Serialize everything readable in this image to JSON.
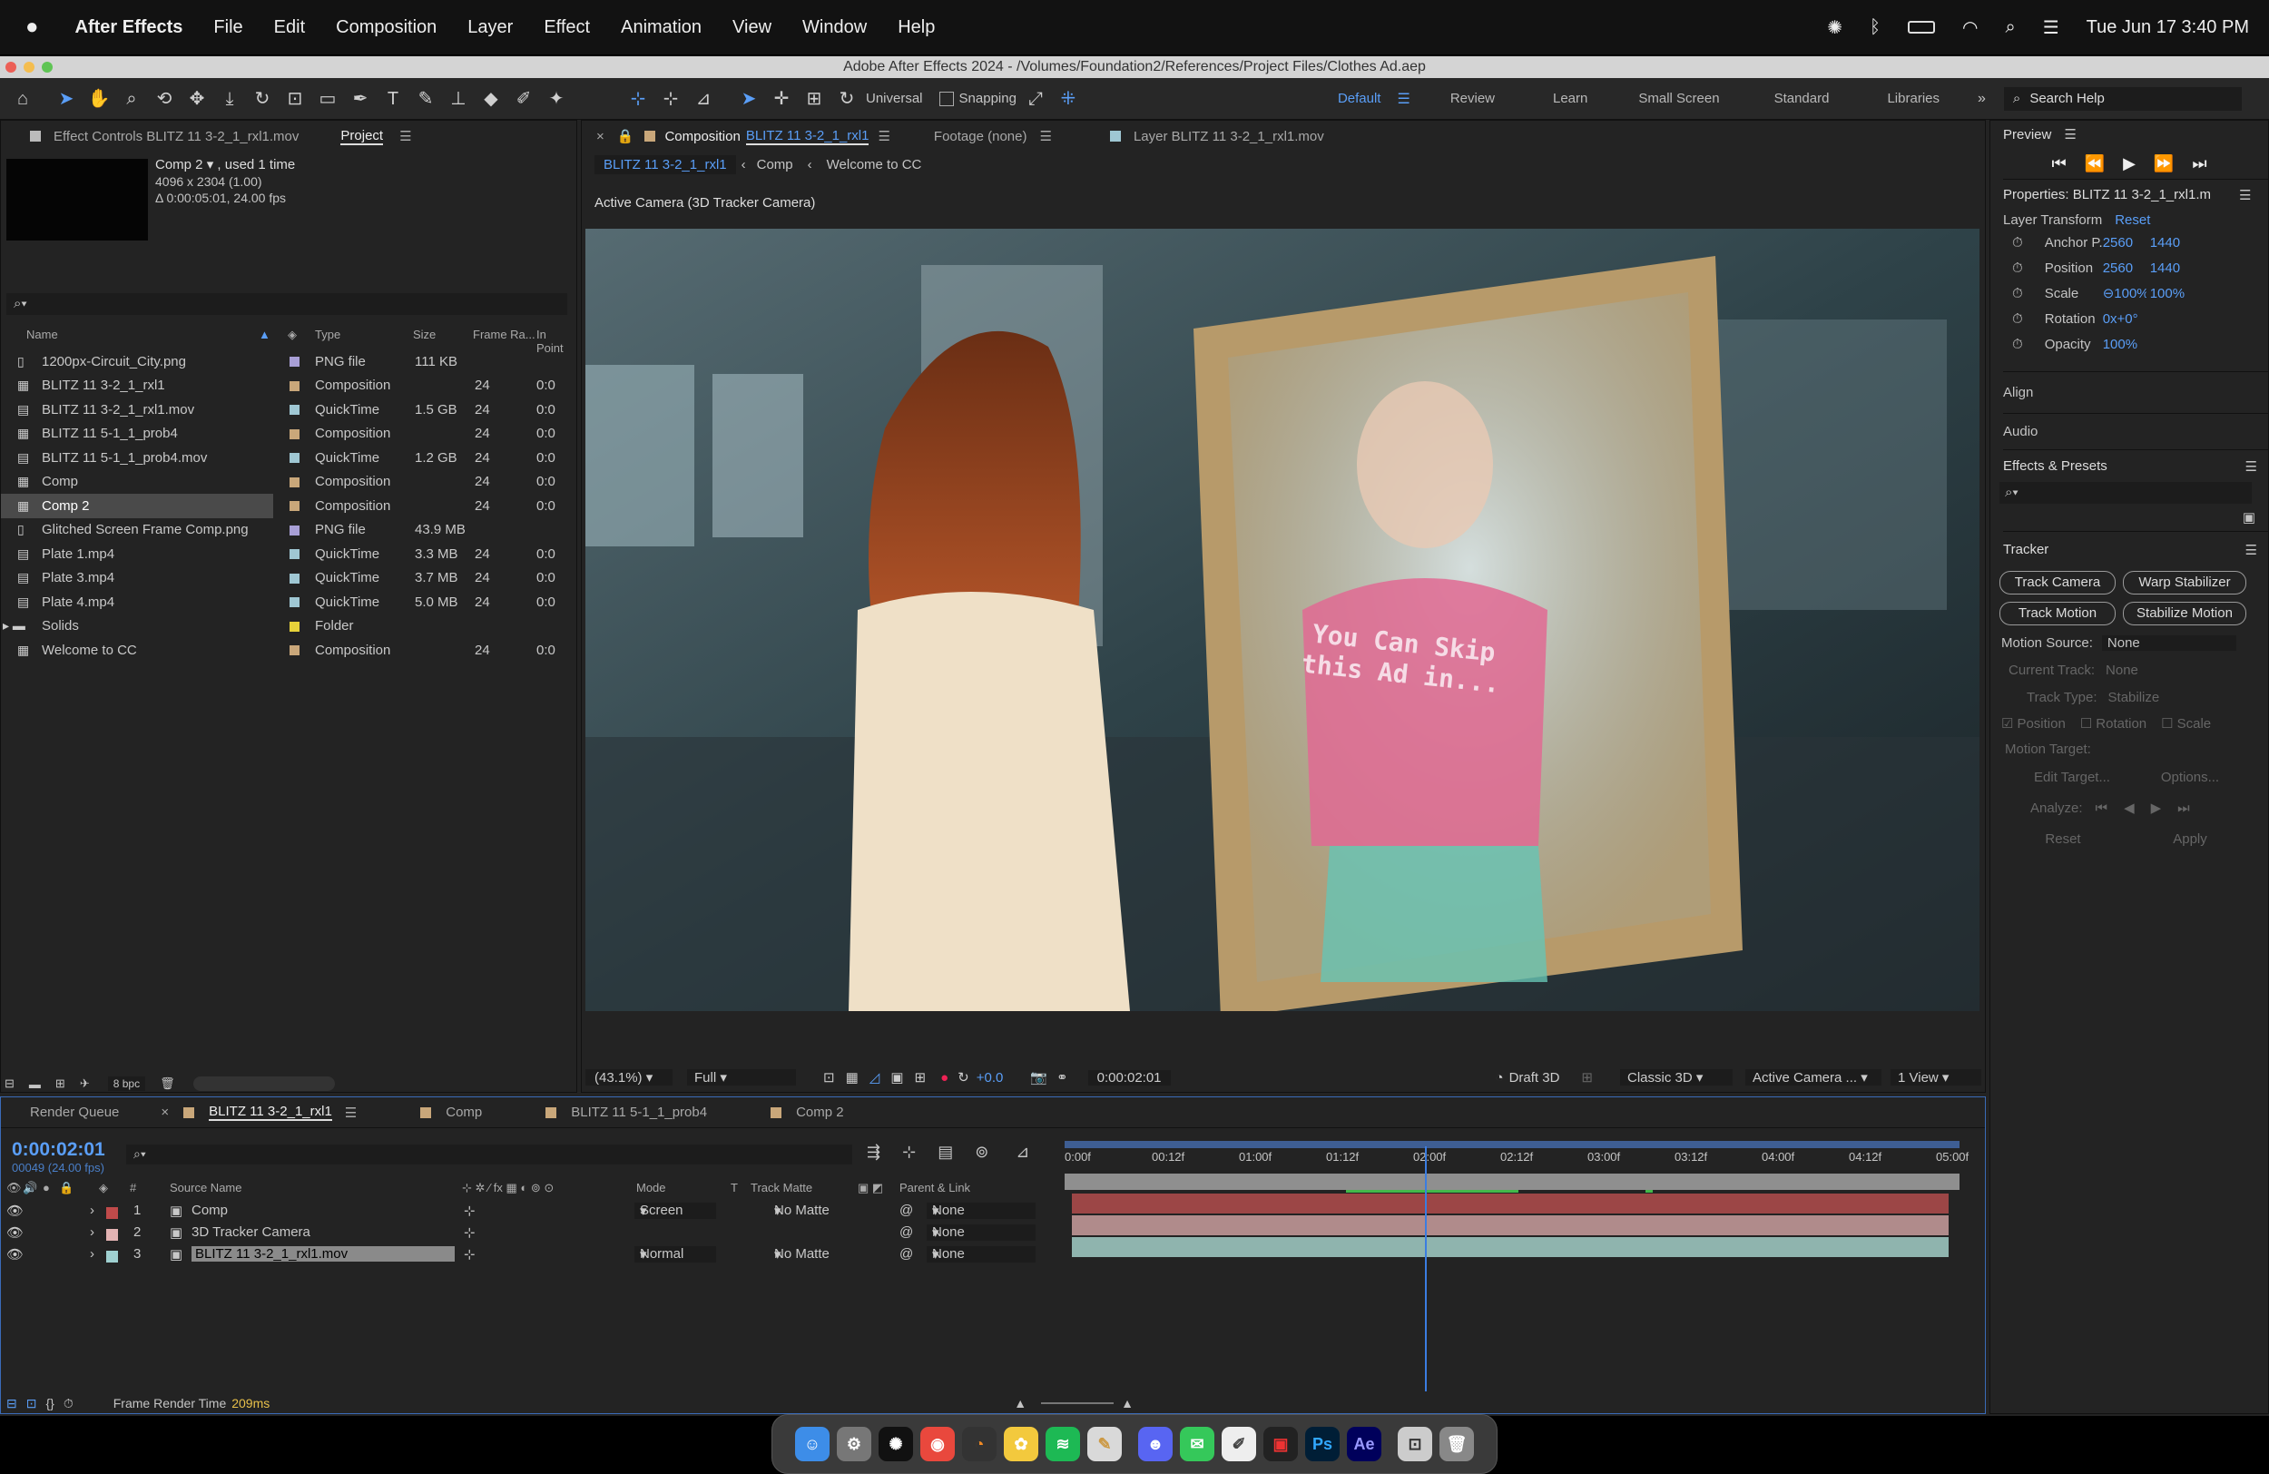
{
  "menubar": {
    "app": "After Effects",
    "items": [
      "File",
      "Edit",
      "Composition",
      "Layer",
      "Effect",
      "Animation",
      "View",
      "Window",
      "Help"
    ],
    "clock": "Tue Jun 17  3:40 PM"
  },
  "window": {
    "title": "Adobe After Effects 2024 - /Volumes/Foundation2/References/Project Files/Clothes Ad.aep"
  },
  "toolbar": {
    "universal": "Universal",
    "snapping": "Snapping",
    "workspaces": [
      "Default",
      "Review",
      "Learn",
      "Small Screen",
      "Standard",
      "Libraries"
    ],
    "search": "Search Help"
  },
  "project": {
    "tab_effect_controls": "Effect Controls BLITZ 11 3-2_1_rxl1.mov",
    "tab_project": "Project",
    "preview_name": "Comp 2 ▾ , used 1 time",
    "preview_info1": "4096 x 2304 (1.00)",
    "preview_info2": "Δ 0:00:05:01, 24.00 fps",
    "search_placeholder": "⌕▾",
    "columns": [
      "Name",
      "Type",
      "Size",
      "Frame Ra...",
      "In Point"
    ],
    "items": [
      {
        "name": "1200px-Circuit_City.png",
        "type": "PNG file",
        "size": "111 KB",
        "fps": "",
        "in": "",
        "color": "#a89fd6"
      },
      {
        "name": "BLITZ 11 3-2_1_rxl1",
        "type": "Composition",
        "size": "",
        "fps": "24",
        "in": "0:0",
        "color": "#c9a77a"
      },
      {
        "name": "BLITZ 11 3-2_1_rxl1.mov",
        "type": "QuickTime",
        "size": "1.5 GB",
        "fps": "24",
        "in": "0:0",
        "color": "#9fc7d3"
      },
      {
        "name": "BLITZ 11 5-1_1_prob4",
        "type": "Composition",
        "size": "",
        "fps": "24",
        "in": "0:0",
        "color": "#c9a77a"
      },
      {
        "name": "BLITZ 11 5-1_1_prob4.mov",
        "type": "QuickTime",
        "size": "1.2 GB",
        "fps": "24",
        "in": "0:0",
        "color": "#9fc7d3"
      },
      {
        "name": "Comp",
        "type": "Composition",
        "size": "",
        "fps": "24",
        "in": "0:0",
        "color": "#c9a77a"
      },
      {
        "name": "Comp 2",
        "type": "Composition",
        "size": "",
        "fps": "24",
        "in": "0:0",
        "color": "#c9a77a"
      },
      {
        "name": "Glitched Screen Frame Comp.png",
        "type": "PNG file",
        "size": "43.9 MB",
        "fps": "",
        "in": "",
        "color": "#a89fd6"
      },
      {
        "name": "Plate 1.mp4",
        "type": "QuickTime",
        "size": "3.3 MB",
        "fps": "24",
        "in": "0:0",
        "color": "#9fc7d3"
      },
      {
        "name": "Plate 3.mp4",
        "type": "QuickTime",
        "size": "3.7 MB",
        "fps": "24",
        "in": "0:0",
        "color": "#9fc7d3"
      },
      {
        "name": "Plate 4.mp4",
        "type": "QuickTime",
        "size": "5.0 MB",
        "fps": "24",
        "in": "0:0",
        "color": "#9fc7d3"
      },
      {
        "name": "Solids",
        "type": "Folder",
        "size": "",
        "fps": "",
        "in": "",
        "color": "#e6d23a"
      },
      {
        "name": "Welcome to CC",
        "type": "Composition",
        "size": "",
        "fps": "24",
        "in": "0:0",
        "color": "#c9a77a"
      }
    ],
    "bpc": "8 bpc"
  },
  "comp": {
    "tab_comp_prefix": "Composition",
    "tab_comp_name": "BLITZ 11 3-2_1_rxl1",
    "tab_footage": "Footage (none)",
    "tab_layer": "Layer BLITZ 11 3-2_1_rxl1.mov",
    "crumbs": [
      "BLITZ 11 3-2_1_rxl1",
      "Comp",
      "Welcome to CC"
    ],
    "camera_label": "Active Camera (3D Tracker Camera)",
    "overlay_text1": "You Can Skip",
    "overlay_text2": "this Ad in...",
    "zoom": "(43.1%)",
    "resolution": "Full",
    "exposure": "+0.0",
    "timecode": "0:00:02:01",
    "draft": "Draft 3D",
    "renderer": "Classic 3D",
    "camera": "Active Camera ...",
    "views": "1 View"
  },
  "right": {
    "preview": "Preview",
    "properties_title": "Properties: BLITZ 11 3-2_1_rxl1.m",
    "layer_transform": "Layer Transform",
    "reset": "Reset",
    "props": [
      {
        "name": "Anchor P...",
        "v1": "2560",
        "v2": "1440"
      },
      {
        "name": "Position",
        "v1": "2560",
        "v2": "1440"
      },
      {
        "name": "Scale",
        "v1": "⊖100%",
        "v2": "100%"
      },
      {
        "name": "Rotation",
        "v1": "0x+0°",
        "v2": ""
      },
      {
        "name": "Opacity",
        "v1": "100%",
        "v2": ""
      }
    ],
    "align": "Align",
    "audio": "Audio",
    "effects_presets": "Effects & Presets",
    "effects_search": "⌕▾",
    "tracker": "Tracker",
    "btn_track_camera": "Track Camera",
    "btn_warp": "Warp Stabilizer",
    "btn_track_motion": "Track Motion",
    "btn_stabilize": "Stabilize Motion",
    "motion_source_label": "Motion Source:",
    "motion_source": "None",
    "current_track_label": "Current Track:",
    "current_track": "None",
    "track_type_label": "Track Type:",
    "track_type": "Stabilize",
    "cb_position": "Position",
    "cb_rotation": "Rotation",
    "cb_scale": "Scale",
    "motion_target": "Motion Target:",
    "edit_target": "Edit Target...",
    "options": "Options...",
    "analyze": "Analyze:",
    "reset_btn": "Reset",
    "apply_btn": "Apply"
  },
  "timeline": {
    "tabs": [
      "Render Queue",
      "BLITZ 11 3-2_1_rxl1",
      "Comp",
      "BLITZ 11 5-1_1_prob4",
      "Comp 2"
    ],
    "timecode": "0:00:02:01",
    "frames": "00049 (24.00 fps)",
    "search": "⌕▾",
    "col_source": "Source Name",
    "col_mode": "Mode",
    "col_t": "T",
    "col_matte": "Track Matte",
    "col_parent": "Parent & Link",
    "ruler": [
      "0:00f",
      "00:12f",
      "01:00f",
      "01:12f",
      "02:00f",
      "02:12f",
      "03:00f",
      "03:12f",
      "04:00f",
      "04:12f",
      "05:00f"
    ],
    "playhead": 0.405,
    "layers": [
      {
        "num": "1",
        "name": "Comp",
        "mode": "Screen",
        "matte": "No Matte",
        "parent": "None",
        "color": "#c04a4a",
        "bar": "#9c4646"
      },
      {
        "num": "2",
        "name": "3D Tracker Camera",
        "mode": "",
        "matte": "",
        "parent": "None",
        "color": "#e3b3b3",
        "bar": "#b08b8b"
      },
      {
        "num": "3",
        "name": "BLITZ 11 3-2_1_rxl1.mov",
        "mode": "Normal",
        "matte": "No Matte",
        "parent": "None",
        "color": "#9fd0d0",
        "bar": "#8fb4ae"
      }
    ],
    "render_time_label": "Frame Render Time",
    "render_time": "209ms"
  },
  "dock": {
    "apps": [
      "Finder",
      "Settings",
      "ChatGPT",
      "Chrome",
      "Blender",
      "Photos",
      "Spotify",
      "Notes",
      "Discord",
      "Messages",
      "Script",
      "Toolkit",
      "Ps",
      "Ae",
      "Screen",
      "Trash"
    ]
  }
}
